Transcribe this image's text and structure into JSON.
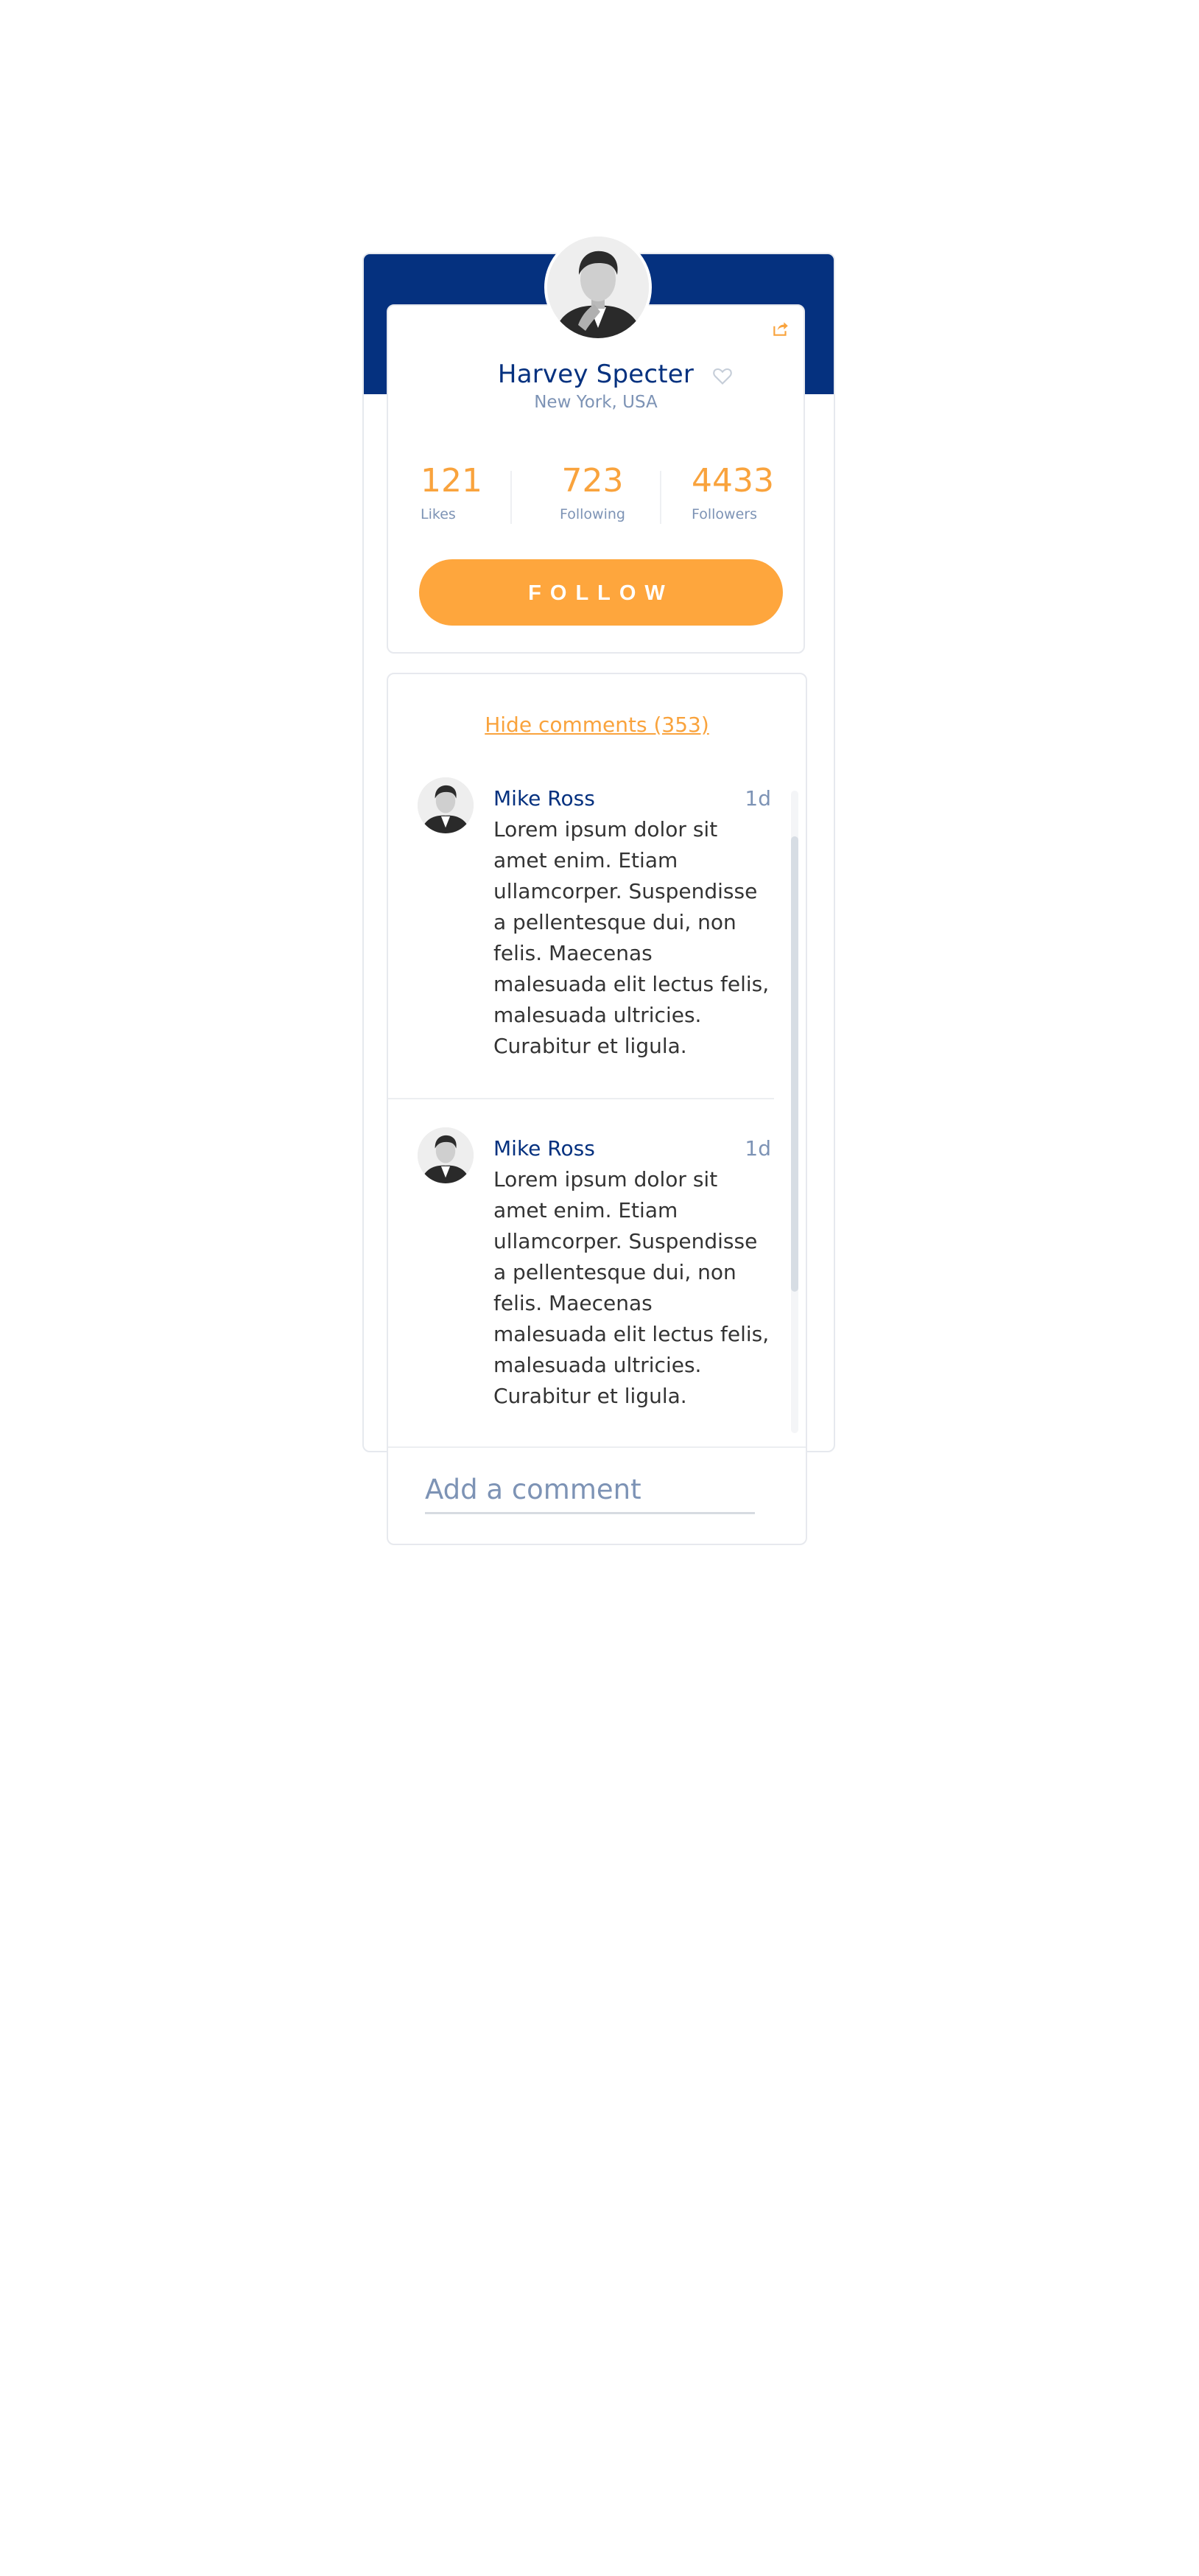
{
  "profile": {
    "name": "Harvey Specter",
    "location": "New York, USA",
    "stats": [
      {
        "value": "121",
        "label": "Likes"
      },
      {
        "value": "723",
        "label": "Following"
      },
      {
        "value": "4433",
        "label": "Followers"
      }
    ],
    "follow_label": "FOLLOW",
    "icons": {
      "share": "share-icon",
      "favorite": "heart-icon",
      "avatar": "avatar-photo"
    }
  },
  "comments": {
    "toggle_label": "Hide comments (353)",
    "items": [
      {
        "author": "Mike Ross",
        "time": "1d",
        "text": "Lorem ipsum dolor sit amet enim. Etiam ullamcorper. Suspendisse a pellentesque dui, non felis. Maecenas malesuada elit lectus felis, malesuada ultricies. Curabitur et ligula."
      },
      {
        "author": "Mike Ross",
        "time": "1d",
        "text": "Lorem ipsum dolor sit amet enim. Etiam ullamcorper. Suspendisse a pellentesque dui, non felis. Maecenas malesuada elit lectus felis, malesuada ultricies. Curabitur et ligula."
      }
    ],
    "input_placeholder": "Add a comment"
  },
  "colors": {
    "brand_navy": "#05317f",
    "accent_orange": "#fea63d",
    "muted_text": "#7d93b5",
    "body_text": "#333333"
  }
}
